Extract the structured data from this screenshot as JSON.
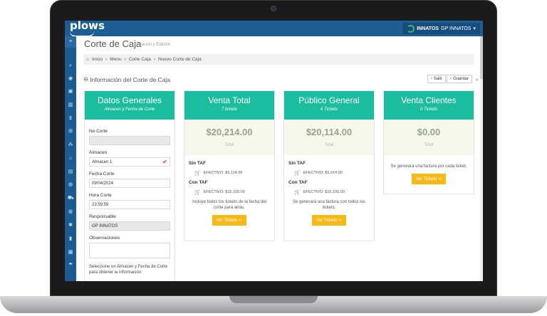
{
  "app": {
    "logo": "plows",
    "org_name": "INNATOS",
    "org_user": "GP INNATOS",
    "org_caret": "▾"
  },
  "page": {
    "title": "Corte de Caja",
    "subtitle": "Creación y Edición"
  },
  "breadcrumb": [
    "Inicio",
    "Menu",
    "Corte Caja",
    "Nuevo Corte de Caja"
  ],
  "breadcrumb_sep": "›",
  "section": {
    "title": "Información del Corte de Caja",
    "salir": "Salir",
    "guardar": "Guardar"
  },
  "form": {
    "title": "Datos Generales",
    "subtitle": "Almacen y Fecha de Corte",
    "no_corte_label": "No Corte",
    "no_corte_value": "",
    "almacen_label": "Almacen",
    "almacen_value": "Almacen 1",
    "fecha_label": "Fecha Corte",
    "fecha_value": "09/04/2024",
    "hora_label": "Hora Corte",
    "hora_value": "23:59:59",
    "responsable_label": "Responsable",
    "responsable_value": "GP INNATOS",
    "obs_label": "Observaciones",
    "note": "Seleccione un Almacen y Fecha de Corte para obtener la información"
  },
  "cards": [
    {
      "title": "Venta Total",
      "tickets": "7 tickets",
      "amount": "$20,214.00",
      "total_label": "Total",
      "g1": "Sin TAF",
      "l1": "EFECTIVO: $5,114.00",
      "g2": "Con TAF",
      "l2": "EFECTIVO: $15,100.00",
      "desc": "Incluye todos los tickets de la fecha del corte para atrás.",
      "btn": "Ver Tickets"
    },
    {
      "title": "Público General",
      "tickets": "6 Tickets",
      "amount": "$20,114.00",
      "total_label": "Total",
      "g1": "Sin TAF",
      "l1": "EFECTIVO: $5,014.00",
      "g2": "Con TAF",
      "l2": "EFECTIVO: $15,100.00",
      "desc": "Se generará una factura con todos los tickets.",
      "btn": "Ver Tickets"
    },
    {
      "title": "Venta Clientes",
      "tickets": "0 Tickets",
      "amount": "$0.00",
      "total_label": "Total",
      "desc": "Se generará una factura por cada ticket.",
      "btn": "Ver Tickets"
    }
  ],
  "icons": [
    "menu-icon",
    "search-icon",
    "eye-icon",
    "calendar-icon",
    "barcode-icon",
    "dollar-icon",
    "box-icon",
    "cubes-icon",
    "bank-icon",
    "list-icon",
    "globe-icon",
    "cart-icon",
    "gear-icon",
    "lock-icon",
    "book-icon",
    "umbrella-icon"
  ]
}
